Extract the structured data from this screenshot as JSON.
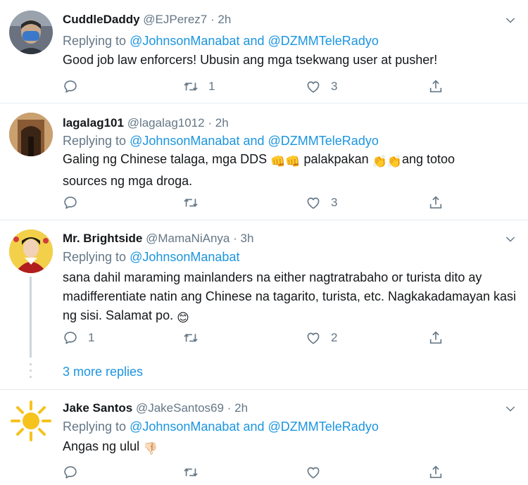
{
  "tweets": [
    {
      "name": "CuddleDaddy",
      "handle": "@EJPerez7",
      "time": "2h",
      "replying_prefix": "Replying to",
      "mentions": [
        "@JohnsonManabat",
        "@DZMMTeleRadyo"
      ],
      "mention_joiner": "and",
      "text": "Good job law enforcers! Ubusin ang mga tsekwang user at pusher!",
      "reply_count": "",
      "retweet_count": "1",
      "like_count": "3"
    },
    {
      "name": "lagalag101",
      "handle": "@lagalag1012",
      "time": "2h",
      "replying_prefix": "Replying to",
      "mentions": [
        "@JohnsonManabat",
        "@DZMMTeleRadyo"
      ],
      "mention_joiner": "and",
      "text_parts": [
        "Galing ng Chinese talaga, mga DDS ",
        " palakpakan ",
        "ang totoo sources ng mga droga."
      ],
      "emoji_fists": "👊👊",
      "emoji_claps": "👏👏",
      "reply_count": "",
      "retweet_count": "",
      "like_count": "3"
    },
    {
      "name": "Mr. Brightside",
      "handle": "@MamaNiAnya",
      "time": "3h",
      "replying_prefix": "Replying to",
      "mentions": [
        "@JohnsonManabat"
      ],
      "text": "sana dahil maraming mainlanders na either nagtratrabaho or turista dito ay madifferentiate natin ang Chinese na tagarito, turista, etc. Nagkakadamayan kasi ng sisi. Salamat po.",
      "emoji_smile": "😊",
      "reply_count": "1",
      "retweet_count": "",
      "like_count": "2",
      "more_replies": "3 more replies"
    },
    {
      "name": "Jake Santos",
      "handle": "@JakeSantos69",
      "time": "2h",
      "replying_prefix": "Replying to",
      "mentions": [
        "@JohnsonManabat",
        "@DZMMTeleRadyo"
      ],
      "mention_joiner": "and",
      "text": "Angas ng ulul",
      "emoji_thumbs_down": "👎🏻",
      "reply_count": "",
      "retweet_count": "",
      "like_count": ""
    }
  ],
  "separator": "·",
  "icons": {
    "reply": "reply-icon",
    "retweet": "retweet-icon",
    "like": "heart-icon",
    "share": "share-icon",
    "menu": "chevron-down-icon"
  },
  "colors": {
    "mention": "#1b95e0",
    "muted": "#657786",
    "divider": "#e6ecf0",
    "thread": "#ccd6dd"
  }
}
